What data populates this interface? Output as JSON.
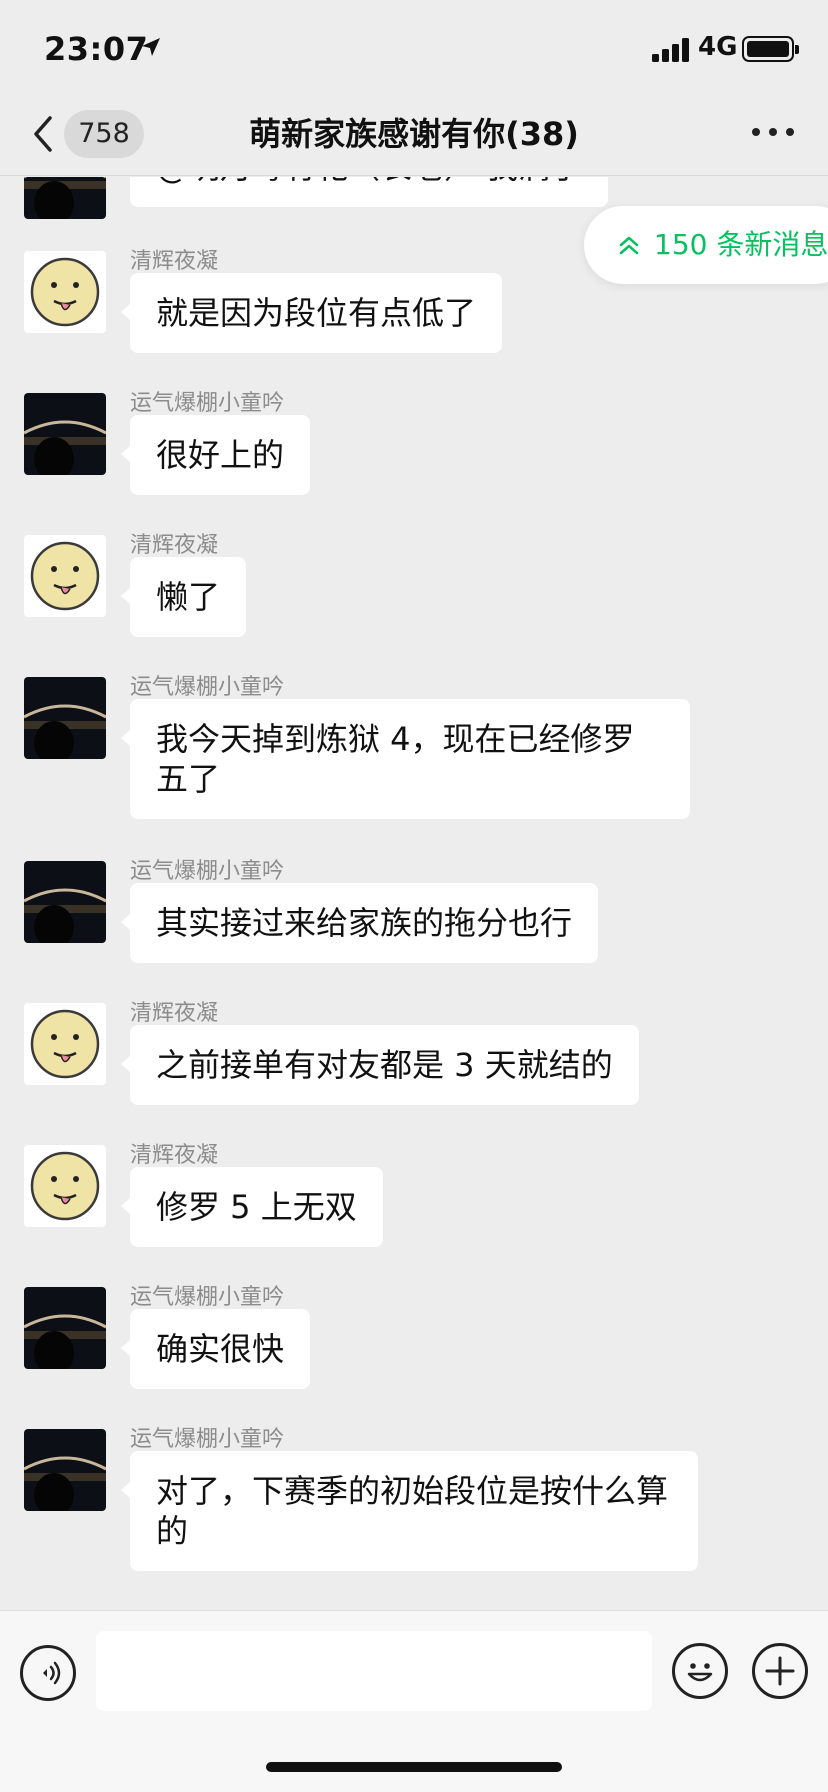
{
  "status_bar": {
    "time": "23:07",
    "network": "4G"
  },
  "nav": {
    "unread_count": "758",
    "title": "萌新家族感谢有你(38)"
  },
  "new_messages": {
    "label": "150 条新消息"
  },
  "messages": [
    {
      "sender": "",
      "avatar": "bridge",
      "text": "@明月每有乾（长老） 我满了"
    },
    {
      "sender": "清辉夜凝",
      "avatar": "face",
      "text": "就是因为段位有点低了"
    },
    {
      "sender": "运气爆棚小童吟",
      "avatar": "bridge",
      "text": "很好上的"
    },
    {
      "sender": "清辉夜凝",
      "avatar": "face",
      "text": "懒了"
    },
    {
      "sender": "运气爆棚小童吟",
      "avatar": "bridge",
      "text": "我今天掉到炼狱 4，现在已经修罗五了"
    },
    {
      "sender": "运气爆棚小童吟",
      "avatar": "bridge",
      "text": "其实接过来给家族的拖分也行"
    },
    {
      "sender": "清辉夜凝",
      "avatar": "face",
      "text": "之前接单有对友都是 3 天就结的"
    },
    {
      "sender": "清辉夜凝",
      "avatar": "face",
      "text": "修罗 5 上无双"
    },
    {
      "sender": "运气爆棚小童吟",
      "avatar": "bridge",
      "text": "确实很快"
    },
    {
      "sender": "运气爆棚小童吟",
      "avatar": "bridge",
      "text": "对了，下赛季的初始段位是按什么算的"
    }
  ],
  "input": {
    "placeholder": ""
  },
  "colors": {
    "accent": "#07c160",
    "background": "#ededed",
    "bubble": "#ffffff"
  },
  "icons": [
    "location-arrow-icon",
    "signal-icon",
    "battery-icon",
    "back-chevron-icon",
    "more-dots-icon",
    "double-chevron-up-icon",
    "voice-icon",
    "emoji-icon",
    "plus-icon"
  ]
}
